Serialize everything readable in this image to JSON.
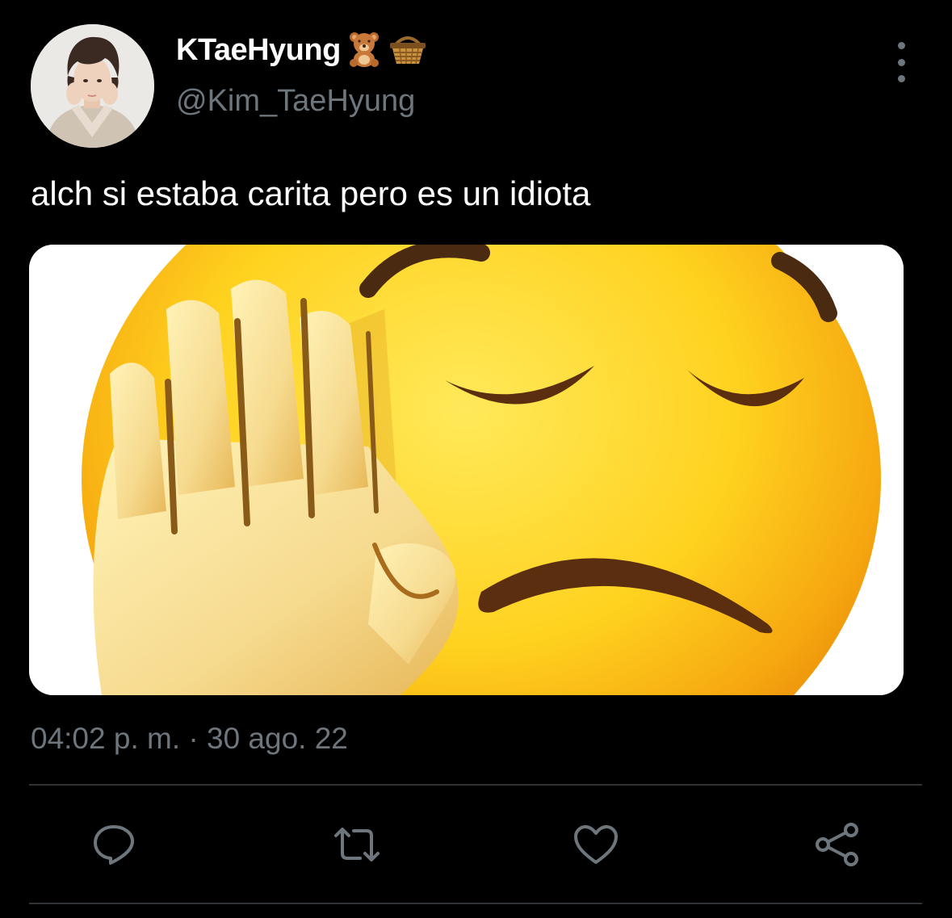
{
  "tweet": {
    "display_name": "KTaeHyung",
    "name_emojis": [
      "teddy-bear-emoji",
      "basket-emoji"
    ],
    "handle": "@Kim_TaeHyung",
    "text": "alch si estaba carita pero es un idiota",
    "timestamp": "04:02 p. m. · 30 ago. 22",
    "media": "facepalm-emoji-image"
  },
  "actions": {
    "reply": "reply-icon",
    "retweet": "retweet-icon",
    "like": "like-icon",
    "share": "share-icon"
  },
  "colors": {
    "background": "#000000",
    "text_primary": "#ffffff",
    "text_secondary": "#6e767d",
    "divider": "#2f3336"
  }
}
